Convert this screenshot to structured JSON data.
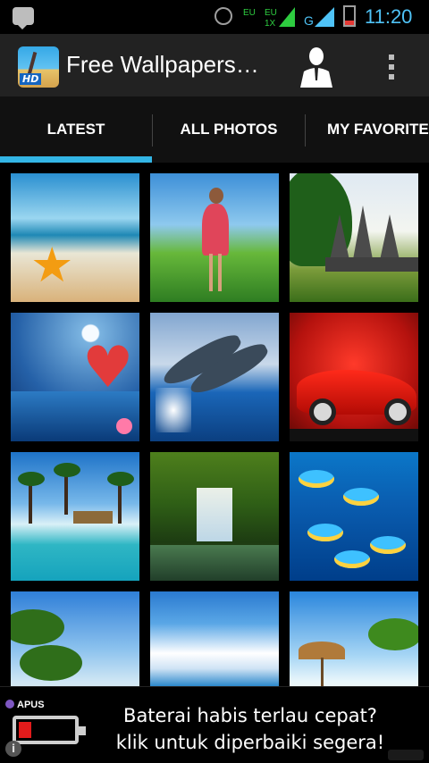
{
  "status_bar": {
    "time": "11:20",
    "carrier_labels": [
      "EU",
      "EU",
      "1X",
      "G"
    ],
    "icons": [
      "bbm-icon",
      "alarm-icon",
      "signal-icon",
      "battery-icon"
    ],
    "battery_level": 0.15
  },
  "action_bar": {
    "title": "Free Wallpapers…",
    "logo_badge": "HD",
    "icons": [
      "app-logo-icon",
      "person-icon",
      "overflow-menu-icon"
    ]
  },
  "tabs": {
    "items": [
      {
        "label": "LATEST",
        "selected": true
      },
      {
        "label": "ALL PHOTOS",
        "selected": false
      },
      {
        "label": "MY FAVORITES",
        "selected": false
      }
    ],
    "indicator_color": "#33b5e5"
  },
  "gallery": {
    "thumbnails": [
      "beach-starfish",
      "girl-in-meadow",
      "temple",
      "heart-ocean",
      "dolphins",
      "red-car",
      "tropical-beach",
      "waterfall",
      "fish-reef",
      "palm-coast",
      "seascape-pier",
      "beach-hut"
    ]
  },
  "ad": {
    "brand": "APUS",
    "line1": "Baterai habis terlau cepat?",
    "line2": "klik untuk diperbaiki segera!",
    "info_label": "i",
    "battery_level": 0.2
  },
  "colors": {
    "accent": "#33b5e5",
    "clock": "#4fc3f7",
    "action_bar": "#222222"
  }
}
